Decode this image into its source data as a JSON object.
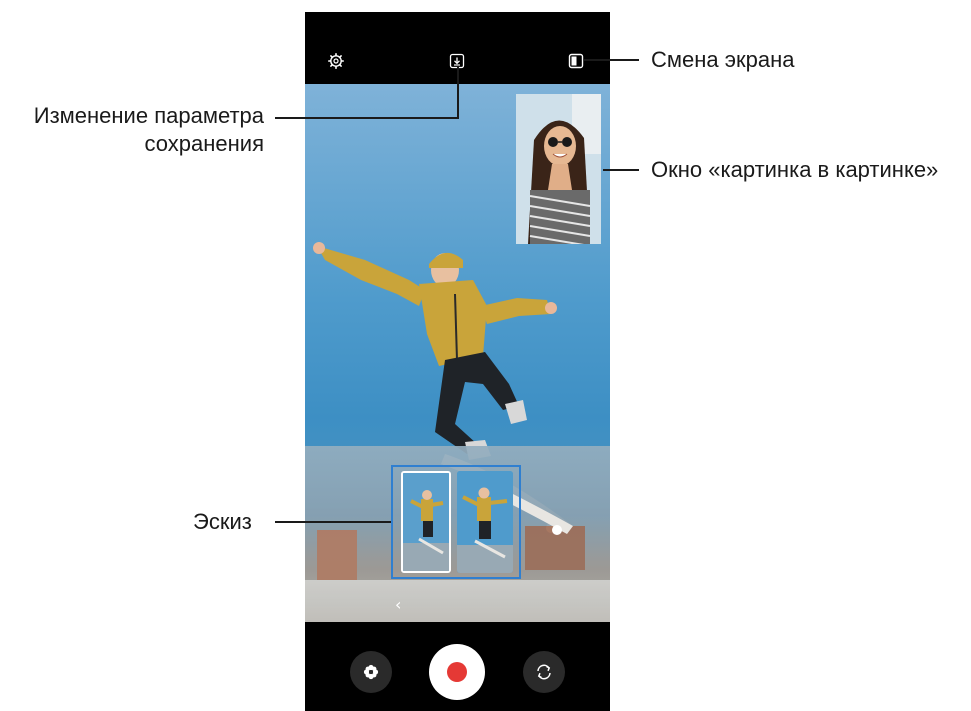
{
  "callouts": {
    "screen_switch": "Смена экрана",
    "save_option_line1": "Изменение параметра",
    "save_option_line2": "сохранения",
    "pip_window": "Окно «картинка в картинке»",
    "thumbnail": "Эскиз"
  },
  "icons": {
    "settings": "gear-icon",
    "save_option": "download-icon",
    "screen_switch": "screen-switch-icon",
    "effects": "flower-icon",
    "record": "record-icon",
    "switch_camera": "camera-switch-icon",
    "back": "chevron-left-icon"
  },
  "colors": {
    "accent_frame": "#2f7fd0",
    "record_red": "#e53935",
    "sky_blue": "#4f9bcc"
  }
}
